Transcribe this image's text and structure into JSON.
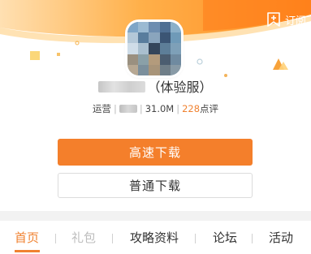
{
  "header": {
    "subscribe_label": "订阅",
    "bg_color": "#ff8a1f",
    "accent_color": "#f47f2b"
  },
  "app": {
    "title_suffix": "（体验服）",
    "meta": {
      "publisher_label": "运营",
      "size": "31.0M",
      "review_count": "228",
      "review_label": "点评"
    }
  },
  "actions": {
    "fast_download": "高速下载",
    "normal_download": "普通下载"
  },
  "tabs": [
    {
      "label": "首页",
      "state": "active"
    },
    {
      "label": "礼包",
      "state": "disabled"
    },
    {
      "label": "攻略资料",
      "state": "normal"
    },
    {
      "label": "论坛",
      "state": "normal"
    },
    {
      "label": "活动",
      "state": "normal"
    }
  ]
}
